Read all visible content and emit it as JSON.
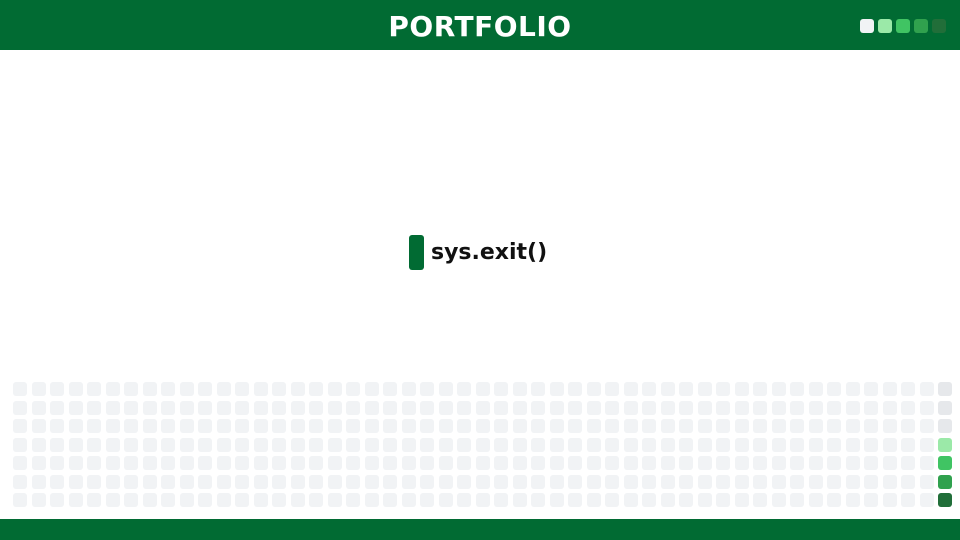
{
  "header": {
    "title": "PORTFOLIO"
  },
  "legend": {
    "colors": [
      "#f1f3f5",
      "#9be9a8",
      "#40c463",
      "#30a14e",
      "#216e39"
    ]
  },
  "main": {
    "code": "sys.exit()"
  },
  "grid": {
    "rows": 7,
    "columns": 51,
    "empty_color": "#f1f3f5",
    "last_column_levels": [
      0,
      0,
      0,
      1,
      2,
      3,
      4
    ]
  },
  "colors": {
    "brand": "#016b33"
  }
}
